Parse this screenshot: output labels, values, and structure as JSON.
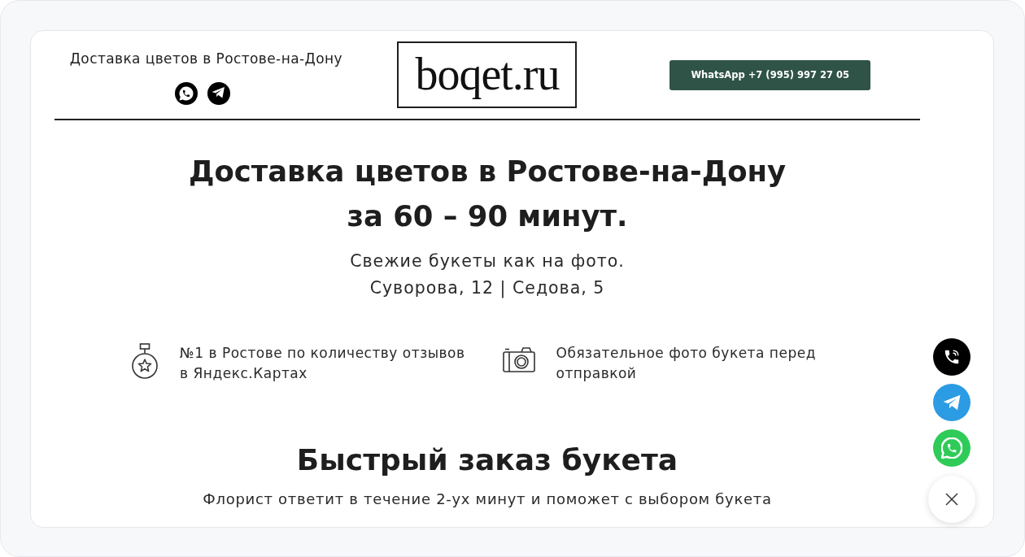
{
  "header": {
    "tagline": "Доставка цветов в Ростове-на-Дону",
    "logo": "boqet.ru",
    "whatsapp_button": "WhatsApp +7 (995) 997 27 05"
  },
  "hero": {
    "title_lines": [
      "Доставка цветов в Ростове-на-Дону",
      "за 60 – 90 минут."
    ],
    "subtitle_lines": [
      "Свежие букеты как на фото.",
      "Суворова, 12 | Седова, 5"
    ]
  },
  "features": [
    {
      "kind": "medal",
      "lines": [
        "№1 в Ростове по количеству отзывов",
        "в Яндекс.Картах"
      ]
    },
    {
      "kind": "camera",
      "lines": [
        "Обязательное фото букета перед",
        "отправкой"
      ]
    }
  ],
  "quick_order": {
    "title": "Быстрый заказ букета",
    "subtitle": "Флорист ответит в течение 2-ух минут и поможет с выбором букета"
  }
}
